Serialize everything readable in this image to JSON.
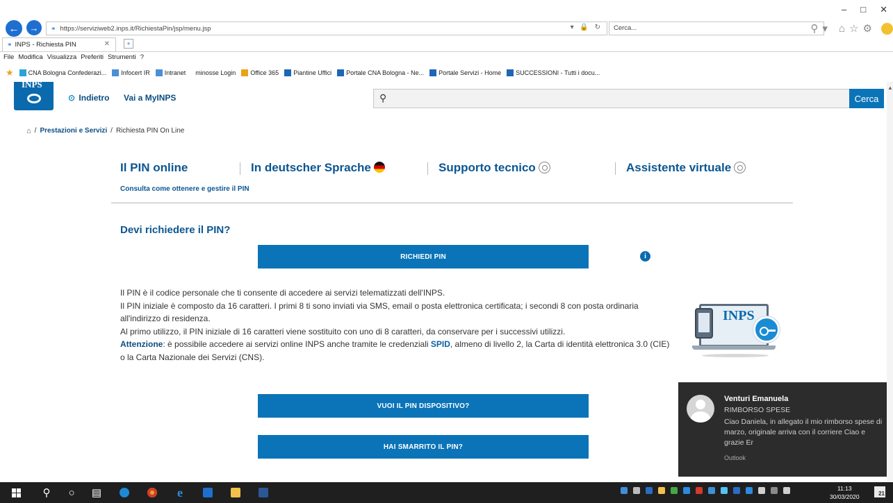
{
  "browser": {
    "url": "https://serviziweb2.inps.it/RichiestaPin/jsp/menu.jsp",
    "search_placeholder": "Cerca...",
    "tab_title": "INPS - Richiesta PIN",
    "menu": [
      "File",
      "Modifica",
      "Visualizza",
      "Preferiti",
      "Strumenti",
      "?"
    ],
    "favorites": [
      "CNA Bologna Confederazi...",
      "Infocert IR",
      "Intranet",
      "minosse Login",
      "Office 365",
      "Piantine Uffici",
      "Portale CNA Bologna - Ne...",
      "Portale Servizi - Home",
      "SUCCESSIONI - Tutti i docu..."
    ]
  },
  "header": {
    "logo_text": "INPS",
    "back": "Indietro",
    "myinps": "Vai a MyINPS",
    "search_button": "Cerca"
  },
  "breadcrumb": {
    "link": "Prestazioni e Servizi",
    "current": "Richiesta PIN On Line"
  },
  "sections": {
    "pin_online": "Il PIN online",
    "deutsch": "In deutscher Sprache",
    "supporto": "Supporto tecnico",
    "assistente": "Assistente virtuale",
    "consulta": "Consulta come ottenere e gestire il PIN"
  },
  "main": {
    "question": "Devi richiedere il PIN?",
    "btn_richiedi": "RICHIEDI PIN",
    "line1": "Il PIN è il codice personale che ti consente di accedere ai servizi telematizzati dell'INPS.",
    "line2": "Il PIN iniziale è composto da 16 caratteri. I primi 8 ti sono inviati via SMS, email o posta elettronica certificata; i secondi 8 con posta ordinaria all'indirizzo di residenza.",
    "line3": "Al primo utilizzo, il PIN iniziale di 16 caratteri viene sostituito con uno di 8 caratteri, da conservare per i successivi utilizzi.",
    "attenzione": "Attenzione",
    "line4a": ": è possibile accedere ai servizi online INPS anche tramite le credenziali ",
    "spid": "SPID",
    "line4b": ", almeno di livello 2, la Carta di identità elettronica 3.0 (CIE) o la Carta Nazionale dei Servizi (CNS).",
    "btn_dispositivo": "VUOI IL PIN DISPOSITIVO?",
    "btn_smarrito": "HAI SMARRITO IL PIN?",
    "illus_brand": "INPS"
  },
  "notification": {
    "sender": "Venturi Emanuela",
    "subject": "RIMBORSO SPESE",
    "body": "Ciao Daniela, in allegato il mio rimborso spese di marzo, originale arriva con il corriere  Ciao e grazie  Er",
    "app": "Outlook"
  },
  "taskbar": {
    "time": "11:13",
    "date": "30/03/2020",
    "notif_count": "21"
  },
  "colors": {
    "inps_blue": "#0b74b8",
    "heading_blue": "#0b5692",
    "toast_bg": "#2c2c2c"
  }
}
